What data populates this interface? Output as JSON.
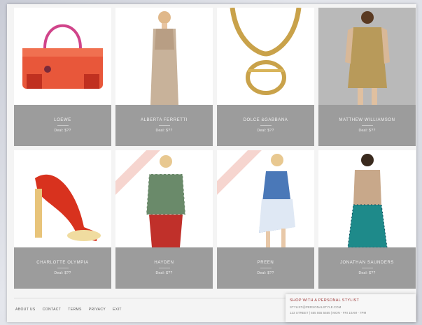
{
  "products": [
    {
      "brand": "LOEWE",
      "deal": "Deal: $??"
    },
    {
      "brand": "ALBERTA FERRETTI",
      "deal": "Deal: $??"
    },
    {
      "brand": "DOLCE &GABBANA",
      "deal": "Deal: $??"
    },
    {
      "brand": "MATTHEW WILLIAMSON",
      "deal": "Deal: $??"
    },
    {
      "brand": "CHARLOTTE OLYMPIA",
      "deal": "Deal: $??"
    },
    {
      "brand": "HAYDEN",
      "deal": "Deal: $??"
    },
    {
      "brand": "PREEN",
      "deal": "Deal: $??"
    },
    {
      "brand": "JONATHAN SAUNDERS",
      "deal": "Deal: $??"
    }
  ],
  "footer": {
    "nav": [
      "ABOUT US",
      "CONTACT",
      "TERMS",
      "PRIVACY",
      "EXIT"
    ],
    "promo": {
      "heading": "SHOP WITH A PERSONAL STYLIST",
      "subline": "STYLIST@PERSONALSTYLE.COM",
      "address": "123 STREET | 555 555 5555 | MON - FRI 10AM - 7PM"
    }
  },
  "colors": {
    "card_info_bg": "#9c9c9c",
    "promo_heading": "#9d3a3a",
    "sash": "#f6d5cf"
  },
  "icons": [
    "handbag-image",
    "dress-model-image",
    "necklace-image",
    "sequin-dress-model-image",
    "sandal-image",
    "gingham-top-model-image",
    "print-dress-model-image",
    "teal-skirt-model-image"
  ]
}
